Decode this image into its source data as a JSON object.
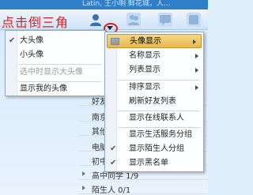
{
  "header": {
    "top_text": "Latin, 王小明 鲜花城，人...",
    "annotation": "点击倒三角"
  },
  "tabs": [
    {
      "icon": "contacts-icon"
    },
    {
      "icon": "group-icon"
    },
    {
      "icon": "chat-icon"
    },
    {
      "icon": "more-icon"
    }
  ],
  "left_menu": {
    "items": [
      {
        "label": "大头像",
        "checked": true
      },
      {
        "label": "小头像",
        "checked": false
      },
      {
        "label": "选中时显示大头像",
        "disabled": true
      },
      {
        "label": "显示我的头像",
        "disabled": false
      }
    ]
  },
  "right_menu": {
    "items": [
      {
        "label": "头像显示",
        "highlight": true,
        "submenu": true
      },
      {
        "label": "名称显示",
        "submenu": true
      },
      {
        "label": "列表显示",
        "submenu": true
      },
      {
        "label": "排序显示",
        "submenu": true
      },
      {
        "label": "刷新好友列表"
      },
      {
        "label": "显示在线联系人"
      },
      {
        "label": "显示生活服务分组"
      },
      {
        "label": "显示陌生人分组",
        "checked": true
      },
      {
        "label": "显示黑名单",
        "checked": true
      }
    ]
  },
  "background_groups": [
    {
      "label": "好友"
    },
    {
      "label": "南京"
    },
    {
      "label": "其他"
    },
    {
      "label": "电脑"
    },
    {
      "label": "初中"
    },
    {
      "label": "高中同学 1/9"
    },
    {
      "label": "陌生人 0/1"
    }
  ]
}
